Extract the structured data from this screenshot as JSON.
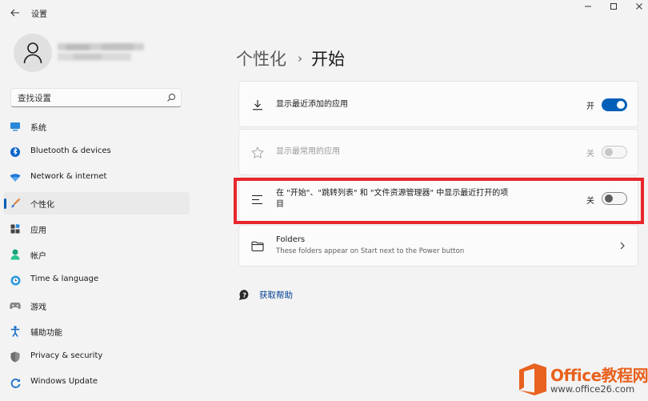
{
  "window": {
    "title": "设置",
    "controls": [
      "minimize-icon",
      "maximize-icon",
      "close-icon"
    ]
  },
  "profile": {
    "name": ""
  },
  "search": {
    "placeholder": "查找设置"
  },
  "sidebar": {
    "items": [
      {
        "label": "系统",
        "icon": "display-icon",
        "active": false
      },
      {
        "label": "Bluetooth & devices",
        "icon": "bluetooth-icon",
        "active": false
      },
      {
        "label": "Network & internet",
        "icon": "wifi-icon",
        "active": false
      },
      {
        "label": "个性化",
        "icon": "brush-icon",
        "active": true
      },
      {
        "label": "应用",
        "icon": "apps-icon",
        "active": false
      },
      {
        "label": "帐户",
        "icon": "account-icon",
        "active": false
      },
      {
        "label": "Time & language",
        "icon": "globe-clock-icon",
        "active": false
      },
      {
        "label": "游戏",
        "icon": "gamepad-icon",
        "active": false
      },
      {
        "label": "辅助功能",
        "icon": "accessibility-icon",
        "active": false
      },
      {
        "label": "Privacy & security",
        "icon": "shield-icon",
        "active": false
      },
      {
        "label": "Windows Update",
        "icon": "update-icon",
        "active": false
      }
    ]
  },
  "main": {
    "breadcrumb": {
      "parent": "个性化",
      "separator": "›",
      "current": "开始"
    },
    "settings": [
      {
        "label": "显示最近添加的应用",
        "icon": "download-icon",
        "state_text": "开",
        "on": true,
        "disabled": false
      },
      {
        "label": "显示最常用的应用",
        "icon": "star-icon",
        "state_text": "关",
        "on": false,
        "disabled": true
      },
      {
        "label": "在 \"开始\"、\"跳转列表\" 和 \"文件资源管理器\" 中显示最近打开的项目",
        "icon": "list-icon",
        "state_text": "关",
        "on": false,
        "disabled": false
      },
      {
        "label": "Folders",
        "sublabel": "These folders appear on Start next to the Power button",
        "icon": "folder-icon"
      }
    ],
    "help": {
      "label": "获取帮助",
      "icon": "help-chat-icon"
    }
  },
  "watermark": {
    "brand": "Office教程网",
    "url": "www.office26.com"
  },
  "colors": {
    "accent": "#005fb8",
    "highlight": "#e8262b",
    "watermark": "#e8611e"
  }
}
